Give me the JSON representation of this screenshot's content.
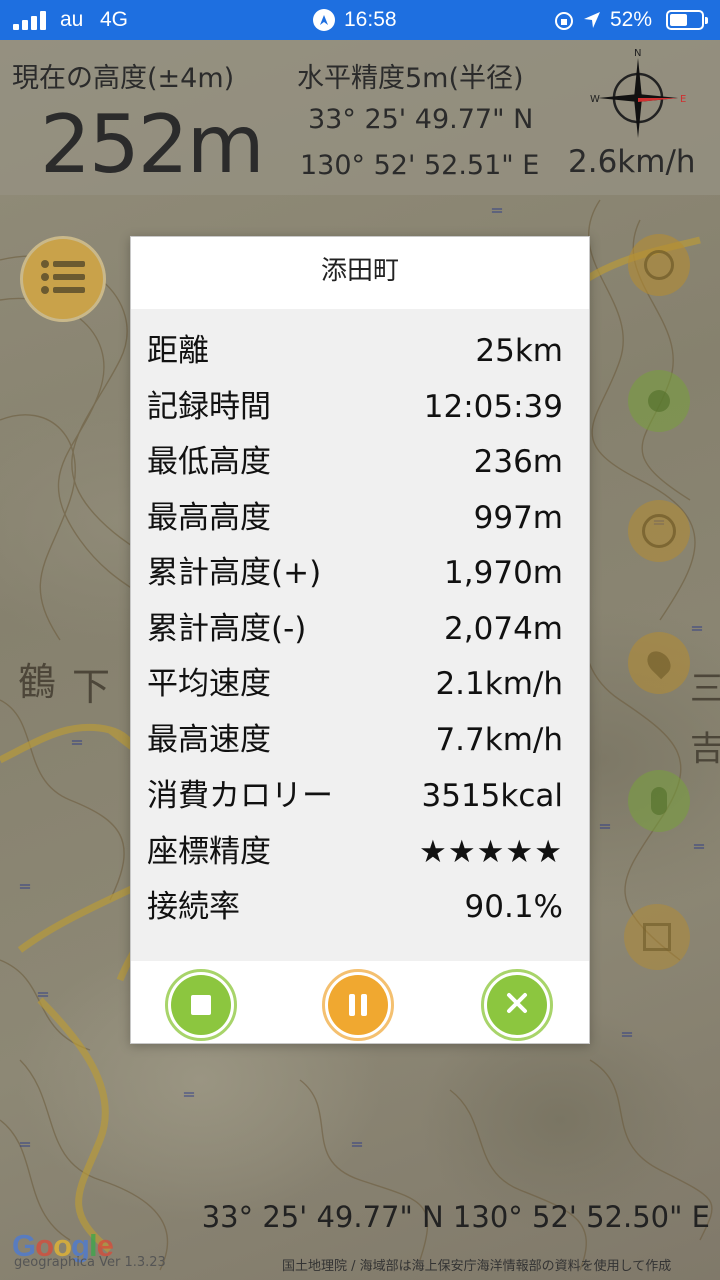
{
  "status_bar": {
    "carrier": "au",
    "network": "4G",
    "time": "16:58",
    "battery": "52%",
    "battery_level": 0.52,
    "icons": [
      "signal-icon",
      "location-arrow-icon",
      "orientation-lock-icon",
      "battery-icon"
    ]
  },
  "info_header": {
    "altitude_label": "現在の高度(±4m)",
    "altitude_value": "252m",
    "accuracy_label": "水平精度5m(半径)",
    "latitude": "33° 25' 49.77\" N",
    "longitude": "130° 52' 52.51\" E",
    "speed": "2.6km/h",
    "compass_icon": "compass-icon"
  },
  "map": {
    "menu_button_icon": "menu-icon",
    "side_buttons": [
      "layers-icon",
      "record-icon",
      "target-icon",
      "pin-icon",
      "footprint-icon",
      "route-icon"
    ]
  },
  "dialog": {
    "title": "添田町",
    "stats": [
      {
        "label": "距離",
        "value": "25km"
      },
      {
        "label": "記録時間",
        "value": "12:05:39"
      },
      {
        "label": "最低高度",
        "value": "236m"
      },
      {
        "label": "最高高度",
        "value": "997m"
      },
      {
        "label": "累計高度(+)",
        "value": "1,970m"
      },
      {
        "label": "累計高度(-)",
        "value": "2,074m"
      },
      {
        "label": "平均速度",
        "value": "2.1km/h"
      },
      {
        "label": "最高速度",
        "value": "7.7km/h"
      },
      {
        "label": "消費カロリー",
        "value": "3515kcal"
      },
      {
        "label": "座標精度",
        "value": "★★★★★"
      },
      {
        "label": "接続率",
        "value": "90.1%"
      }
    ],
    "buttons": {
      "stop_icon": "stop-icon",
      "pause_icon": "pause-icon",
      "close_icon": "close-icon"
    },
    "colors": {
      "green": "#8cc63f",
      "orange": "#f0a830"
    }
  },
  "bottom": {
    "coordinates": "33° 25' 49.77\" N 130° 52' 52.50\" E",
    "google_logo": "Google",
    "app_version": "geographica Ver 1.3.23",
    "attribution": "国土地理院 / 海域部は海上保安庁海洋情報部の資料を使用して作成"
  }
}
